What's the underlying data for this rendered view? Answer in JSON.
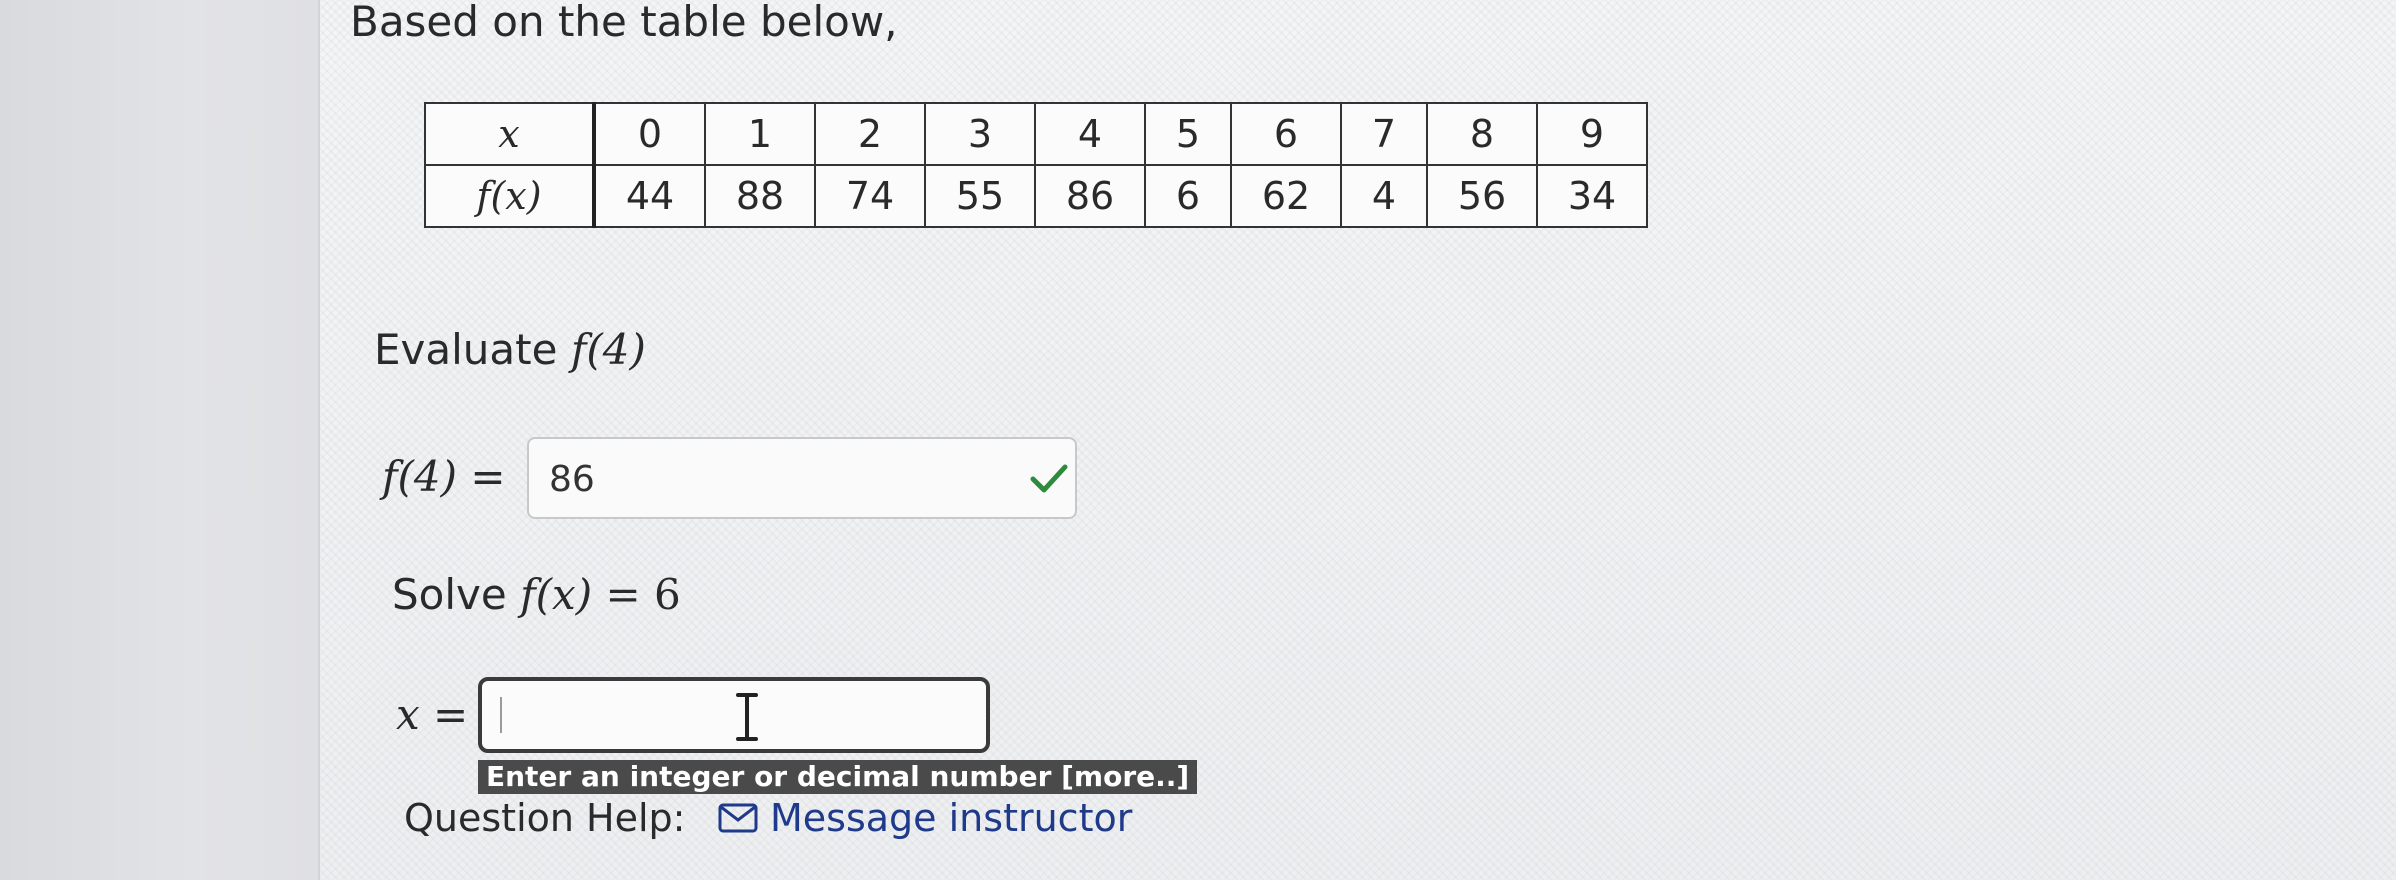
{
  "intro": "Based on the table below,",
  "table": {
    "x_header": "x",
    "fx_header": "f(x)",
    "x_values": [
      "0",
      "1",
      "2",
      "3",
      "4",
      "5",
      "6",
      "7",
      "8",
      "9"
    ],
    "fx_values": [
      "44",
      "88",
      "74",
      "55",
      "86",
      "6",
      "62",
      "4",
      "56",
      "34"
    ]
  },
  "question1": {
    "prefix": "Evaluate ",
    "expr": "f(4)",
    "label": "f(4)",
    "equals": "=",
    "answer": "86",
    "status_icon": "checkmark-icon",
    "status_color": "#2e8b3d"
  },
  "question2": {
    "prefix": "Solve ",
    "expr_f": "f(x)",
    "expr_eq": "= 6",
    "label": "x",
    "equals": "=",
    "answer": "",
    "hint": "Enter an integer or decimal number [more..]"
  },
  "help": {
    "label": "Question Help:",
    "link_icon": "mail-icon",
    "link_label": "Message instructor"
  }
}
